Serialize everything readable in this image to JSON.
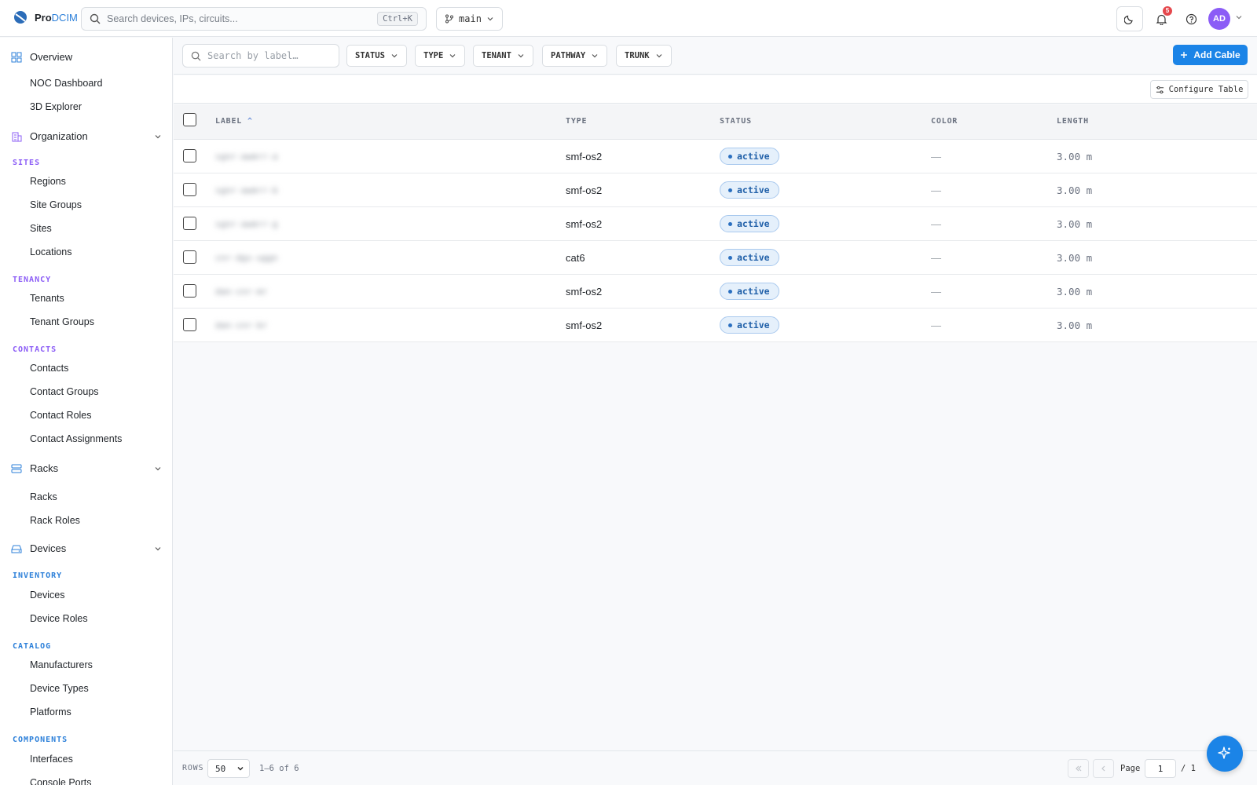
{
  "app": {
    "name_pro": "Pro",
    "name_dcim": "DCIM"
  },
  "header": {
    "search_placeholder": "Search devices, IPs, circuits...",
    "search_shortcut": "Ctrl+K",
    "branch": "main",
    "notification_count": "5",
    "avatar_initials": "AD"
  },
  "sidebar": {
    "overview": "Overview",
    "overview_items": [
      "NOC Dashboard",
      "3D Explorer"
    ],
    "organization": "Organization",
    "sites_section": "SITES",
    "sites_items": [
      "Regions",
      "Site Groups",
      "Sites",
      "Locations"
    ],
    "tenancy_section": "TENANCY",
    "tenancy_items": [
      "Tenants",
      "Tenant Groups"
    ],
    "contacts_section": "CONTACTS",
    "contacts_items": [
      "Contacts",
      "Contact Groups",
      "Contact Roles",
      "Contact Assignments"
    ],
    "racks": "Racks",
    "racks_items": [
      "Racks",
      "Rack Roles"
    ],
    "devices": "Devices",
    "inventory_section": "INVENTORY",
    "inventory_items": [
      "Devices",
      "Device Roles"
    ],
    "catalog_section": "CATALOG",
    "catalog_items": [
      "Manufacturers",
      "Device Types",
      "Platforms"
    ],
    "components_section": "COMPONENTS",
    "components_items": [
      "Interfaces",
      "Console Ports"
    ]
  },
  "toolbar": {
    "search_placeholder": "Search by label…",
    "filters": [
      "STATUS",
      "TYPE",
      "TENANT",
      "PATHWAY",
      "TRUNK"
    ],
    "add_label": "Add Cable",
    "configure_label": "Configure Table"
  },
  "table": {
    "columns": {
      "label": "LABEL",
      "type": "TYPE",
      "status": "STATUS",
      "color": "COLOR",
      "length": "LENGTH"
    },
    "rows": [
      {
        "label": "sgnr-awmrr-a",
        "type": "smf-os2",
        "status": "active",
        "color": "—",
        "length": "3.00 m"
      },
      {
        "label": "sgnr-awmrr-b",
        "type": "smf-os2",
        "status": "active",
        "color": "—",
        "length": "3.00 m"
      },
      {
        "label": "sgnr-awmrr-g",
        "type": "smf-os2",
        "status": "active",
        "color": "—",
        "length": "3.00 m"
      },
      {
        "label": "cnr-dgs-uggn",
        "type": "cat6",
        "status": "active",
        "color": "—",
        "length": "3.00 m"
      },
      {
        "label": "dan-cnr-mr",
        "type": "smf-os2",
        "status": "active",
        "color": "—",
        "length": "3.00 m"
      },
      {
        "label": "dan-cnr-br",
        "type": "smf-os2",
        "status": "active",
        "color": "—",
        "length": "3.00 m"
      }
    ]
  },
  "footer": {
    "rows_label": "ROWS",
    "rows_value": "50",
    "range": "1–6 of 6",
    "page_label": "Page",
    "page_value": "1",
    "page_total": "/ 1"
  },
  "colors": {
    "accent": "#1b84e7",
    "section": "#2b7fd9",
    "section_purple": "#8b5cf6",
    "avatar": "#8b5cf6",
    "badge_bg": "#e5f0fb"
  },
  "icons": {
    "logo": "globe-logo-icon",
    "search": "search-icon",
    "branch": "git-branch-icon",
    "theme": "moon-icon",
    "bell": "bell-icon",
    "help": "help-icon",
    "ai": "sparkle-icon"
  }
}
